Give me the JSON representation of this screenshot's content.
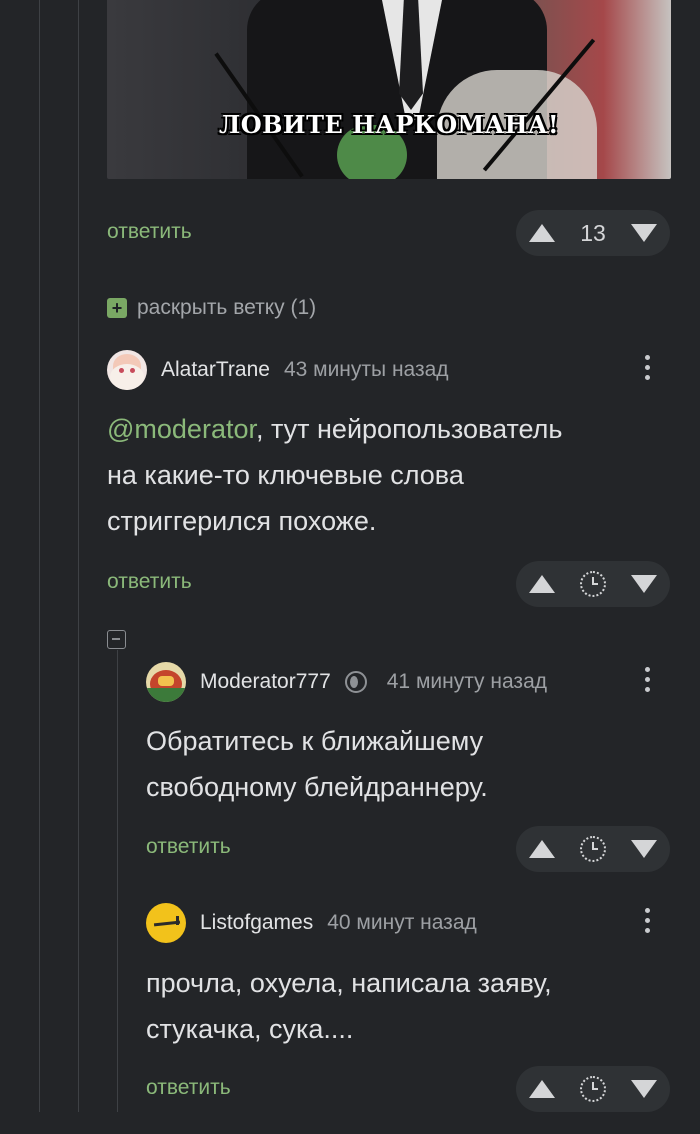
{
  "image_post": {
    "caption": "ЛОВИТЕ НАРКОМАНА!",
    "reply_label": "ответить",
    "rating": "13"
  },
  "expand_thread": {
    "label": "раскрыть ветку (1)"
  },
  "comments": [
    {
      "username": "AlatarTrane",
      "time": "43 минуты назад",
      "mention": "@moderator",
      "text_lines": [
        "@moderator, тут нейропользователь",
        "на какие-то ключевые слова",
        "стриггерился похоже."
      ],
      "text_after_mention": ", тут нейропользователь",
      "line2": "на какие-то ключевые слова",
      "line3": "стриггерился похоже.",
      "reply_label": "ответить"
    },
    {
      "username": "Moderator777",
      "time": "41 минуту назад",
      "line1": "Обратитесь к ближайшему",
      "line2": "свободному блейдраннеру.",
      "reply_label": "ответить"
    },
    {
      "username": "Listofgames",
      "time": "40 минут назад",
      "line1": "прочла, охуела, написала заяву,",
      "line2": "стукачка, сука....",
      "reply_label": "ответить"
    }
  ],
  "colors": {
    "background": "#232528",
    "accent_green": "#8bb97a",
    "vote_bg": "#2f3235"
  },
  "icons": [
    "arrow-up-icon",
    "arrow-down-icon",
    "clock-icon",
    "more-icon",
    "plus-icon",
    "minus-icon",
    "moderator-badge-icon"
  ]
}
